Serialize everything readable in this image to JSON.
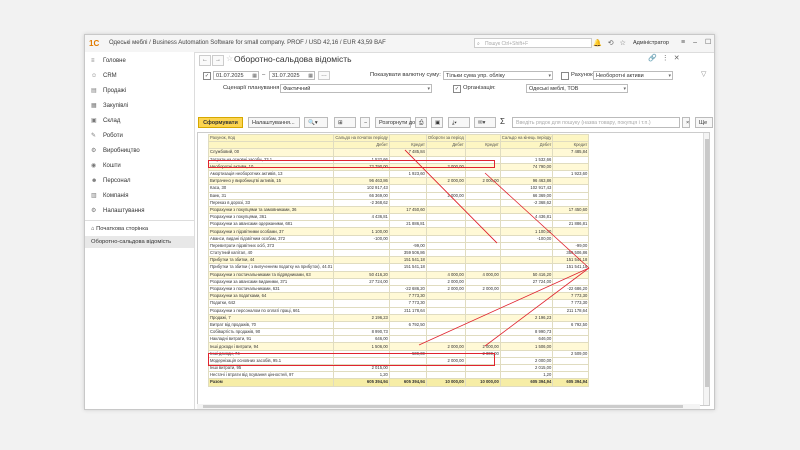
{
  "titlebar": {
    "logo": "1С",
    "title": "Одеські меблі / Business Automation Software for small company. PROF / USD 42,16 / EUR 43,59 BAF",
    "search_placeholder": "Пошук Ctrl+Shift+F",
    "user": "Адміністратор"
  },
  "sidebar": {
    "items": [
      {
        "icon": "menu-icon",
        "label": "Головне"
      },
      {
        "icon": "crm-icon",
        "label": "CRM"
      },
      {
        "icon": "sales-icon",
        "label": "Продажі"
      },
      {
        "icon": "purchases-icon",
        "label": "Закупівлі"
      },
      {
        "icon": "warehouse-icon",
        "label": "Склад"
      },
      {
        "icon": "works-icon",
        "label": "Роботи"
      },
      {
        "icon": "production-icon",
        "label": "Виробництво"
      },
      {
        "icon": "money-icon",
        "label": "Кошти"
      },
      {
        "icon": "staff-icon",
        "label": "Персонал"
      },
      {
        "icon": "company-icon",
        "label": "Компанія"
      },
      {
        "icon": "settings-icon",
        "label": "Налаштування"
      }
    ],
    "open_windows": [
      "Початкова сторінка",
      "Оборотно-сальдова відомість"
    ]
  },
  "header": {
    "title": "Оборотно-сальдова відомість"
  },
  "filters": {
    "date_from": "01.07.2025",
    "date_to": "31.07.2025",
    "planning_label": "Сценарії планування:",
    "planning_value": "Фактичний",
    "currency_label": "Показувати валютну суму:",
    "currency_value": "Тільки сума упр. обліку",
    "org_label": "Організація:",
    "org_value": "Одеські меблі, ТОВ",
    "account_label": "Рахунок:",
    "account_value": "Необоротні активи"
  },
  "toolbar": {
    "generate": "Сформувати",
    "settings": "Налаштування...",
    "expand": "Розгорнути до",
    "search_placeholder": "Введіть рядок для пошуку (назва товару, покупця і т.п.)",
    "more": "Ще"
  },
  "report": {
    "header1": [
      "Рахунок, Код",
      "Сальдо на початок періоду",
      "",
      "Обороти за період",
      "",
      "Сальдо на кінець періоду",
      ""
    ],
    "header2": [
      "",
      "Дебет",
      "Кредит",
      "Дебет",
      "Кредит",
      "Дебет",
      "Кредит"
    ],
    "rows": [
      {
        "s": "y",
        "c": [
          "Службовий, 00",
          "",
          "7 485,84",
          "",
          "",
          "",
          "7 485,84"
        ]
      },
      {
        "s": "",
        "c": [
          "Затрати на основні засоби, 23.1",
          "1 532,66",
          "",
          "",
          "",
          "1 532,66",
          ""
        ]
      },
      {
        "s": "y",
        "c": [
          "Необоротні активи, 10",
          "72 790,00",
          "",
          "2 000,00",
          "",
          "74 790,00",
          ""
        ]
      },
      {
        "s": "",
        "c": [
          "Амортизація необоротних активів, 13",
          "",
          "1 923,60",
          "",
          "",
          "",
          "1 923,60"
        ]
      },
      {
        "s": "y",
        "c": [
          "Витрачено у виробництві активів, 15",
          "96 463,86",
          "",
          "2 000,00",
          "2 000,00",
          "96 463,86",
          ""
        ]
      },
      {
        "s": "",
        "c": [
          "Каса, 30",
          "102 917,43",
          "",
          "",
          "",
          "102 917,43",
          ""
        ]
      },
      {
        "s": "",
        "c": [
          "Банк, 31",
          "66 369,00",
          "",
          "2 000,00",
          "",
          "66 369,00",
          ""
        ]
      },
      {
        "s": "",
        "c": [
          "Переказ в дорозі, 33",
          "-2 368,62",
          "",
          "",
          "",
          "-2 368,62",
          ""
        ]
      },
      {
        "s": "y",
        "c": [
          "Розрахунки з покупцями та замовниками, 36",
          "",
          "17 450,60",
          "",
          "",
          "",
          "17 450,60"
        ]
      },
      {
        "s": "",
        "c": [
          "Розрахунки з покупцями, 361",
          "4 436,81",
          "",
          "",
          "",
          "4 436,81",
          ""
        ]
      },
      {
        "s": "",
        "c": [
          "Розрахунки за авансами одержаними, 681",
          "",
          "21 886,81",
          "",
          "",
          "",
          "21 886,81"
        ]
      },
      {
        "s": "y",
        "c": [
          "Розрахунки з підзвітними особами, 37",
          "1 100,00",
          "",
          "",
          "",
          "1 100,00",
          ""
        ]
      },
      {
        "s": "",
        "c": [
          "Аванси, видані підзвітним особам, 372",
          "-100,00",
          "",
          "",
          "",
          "-100,00",
          ""
        ]
      },
      {
        "s": "",
        "c": [
          "Перевитрати підзвітних осіб, 373",
          "",
          "-99,00",
          "",
          "",
          "",
          "-99,00"
        ]
      },
      {
        "s": "",
        "c": [
          "Статутний капітал, 40",
          "",
          "359 506,86",
          "",
          "",
          "",
          "359 506,86"
        ]
      },
      {
        "s": "y",
        "c": [
          "Прибутки та збитки, 44",
          "",
          "151 541,18",
          "",
          "",
          "",
          "151 541,18"
        ]
      },
      {
        "s": "",
        "c": [
          "Прибутки та збитки ( з вилученням податку на прибуток), 44.01",
          "",
          "151 541,18",
          "",
          "",
          "",
          "151 541,18"
        ]
      },
      {
        "s": "y",
        "c": [
          "Розрахунки з постачальниками та підрядниками, 63",
          "50 416,20",
          "",
          "4 000,00",
          "4 000,00",
          "50 416,20",
          ""
        ]
      },
      {
        "s": "",
        "c": [
          "Розрахунки за авансами виданими, 371",
          "27 724,00",
          "",
          "2 000,00",
          "",
          "27 724,00",
          ""
        ]
      },
      {
        "s": "",
        "c": [
          "Розрахунки з постачальниками, 631",
          "",
          "-22 686,20",
          "2 000,00",
          "2 000,00",
          "",
          "-22 686,20"
        ]
      },
      {
        "s": "y",
        "c": [
          "Розрахунки за податками, 64",
          "",
          "7 773,30",
          "",
          "",
          "",
          "7 773,30"
        ]
      },
      {
        "s": "",
        "c": [
          "Податки, 642",
          "",
          "7 773,30",
          "",
          "",
          "",
          "7 773,30"
        ]
      },
      {
        "s": "",
        "c": [
          "Розрахунки з персоналом по оплаті праці, 661",
          "",
          "211 178,64",
          "",
          "",
          "",
          "211 178,64"
        ]
      },
      {
        "s": "y",
        "c": [
          "Продажі, 7",
          "2 196,23",
          "",
          "",
          "",
          "2 196,23",
          ""
        ]
      },
      {
        "s": "",
        "c": [
          "Витрат від продажів, 70",
          "",
          "6 792,50",
          "",
          "",
          "",
          "6 792,50"
        ]
      },
      {
        "s": "",
        "c": [
          "Собівартість продажів, 90",
          "8 990,73",
          "",
          "",
          "",
          "8 990,73",
          ""
        ]
      },
      {
        "s": "",
        "c": [
          "Накладні витрати, 91",
          "646,00",
          "",
          "",
          "",
          "646,00",
          ""
        ]
      },
      {
        "s": "y",
        "c": [
          "Інші доходи і витрати, 94",
          "1 506,00",
          "",
          "2 000,00",
          "2 000,00",
          "1 506,00",
          ""
        ]
      },
      {
        "s": "",
        "c": [
          "Інші доходи, 74",
          "",
          "509,00",
          "",
          "2 000,00",
          "",
          "2 509,00"
        ]
      },
      {
        "s": "",
        "c": [
          "Модернізація основних засобів, 95.1",
          "",
          "",
          "2 000,00",
          "",
          "2 000,00",
          ""
        ]
      },
      {
        "s": "",
        "c": [
          "Інші витрати, 95",
          "2 015,00",
          "",
          "",
          "",
          "2 015,00",
          ""
        ]
      },
      {
        "s": "",
        "c": [
          "Нестачі і втрати від псування цінностей, 97",
          "1,20",
          "",
          "",
          "",
          "1,20",
          ""
        ]
      },
      {
        "s": "t",
        "c": [
          "Разом",
          "605 394,94",
          "605 394,94",
          "10 000,00",
          "10 000,00",
          "605 394,94",
          "605 394,94"
        ]
      }
    ]
  }
}
